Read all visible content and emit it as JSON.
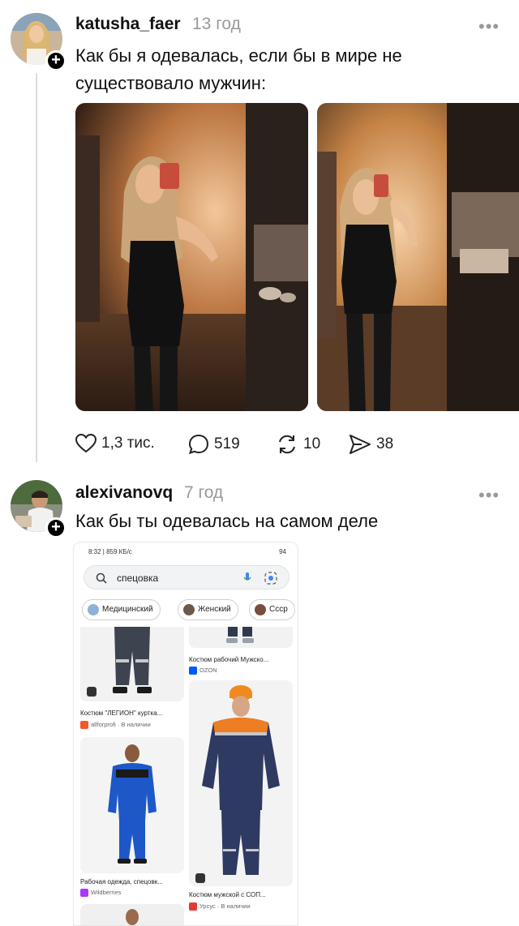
{
  "posts": [
    {
      "username": "katusha_faer",
      "ago": "13 год",
      "text_line1": "Как бы я одевалась, если бы в мире не",
      "text_line2": "существовало мужчин:",
      "likes": "1,3 тис.",
      "comments": "519",
      "reposts": "10",
      "shares": "38"
    },
    {
      "username": "alexivanovq",
      "ago": "7 год",
      "text": "Как бы ты одевалась на самом деле"
    }
  ],
  "more_label": "•••",
  "plus_label": "+",
  "screenshot": {
    "status_left": "8:32 | 859 КБ/с",
    "status_right": "94",
    "search_query": "спецовка",
    "chips": [
      "Медицинский",
      "Женский",
      "Ссср"
    ],
    "products": [
      {
        "title": "Костюм рабочий Мужско...",
        "shop": "OZON"
      },
      {
        "title": "Костюм \"ЛЕГИОН\" куртка...",
        "shop": "allforprofi · В наличии"
      },
      {
        "title": "Рабочая одежда, спецовк...",
        "shop": "Wildberries"
      },
      {
        "title": "Костюм мужской с СОП...",
        "shop": "Урсус · В наличии"
      }
    ]
  },
  "colors": {
    "accent_dark": "#111111",
    "muted": "#999999",
    "ozon": "#005bff",
    "wildberries": "#a73afd",
    "allforprofi": "#f05a28",
    "ursus": "#e53935"
  }
}
